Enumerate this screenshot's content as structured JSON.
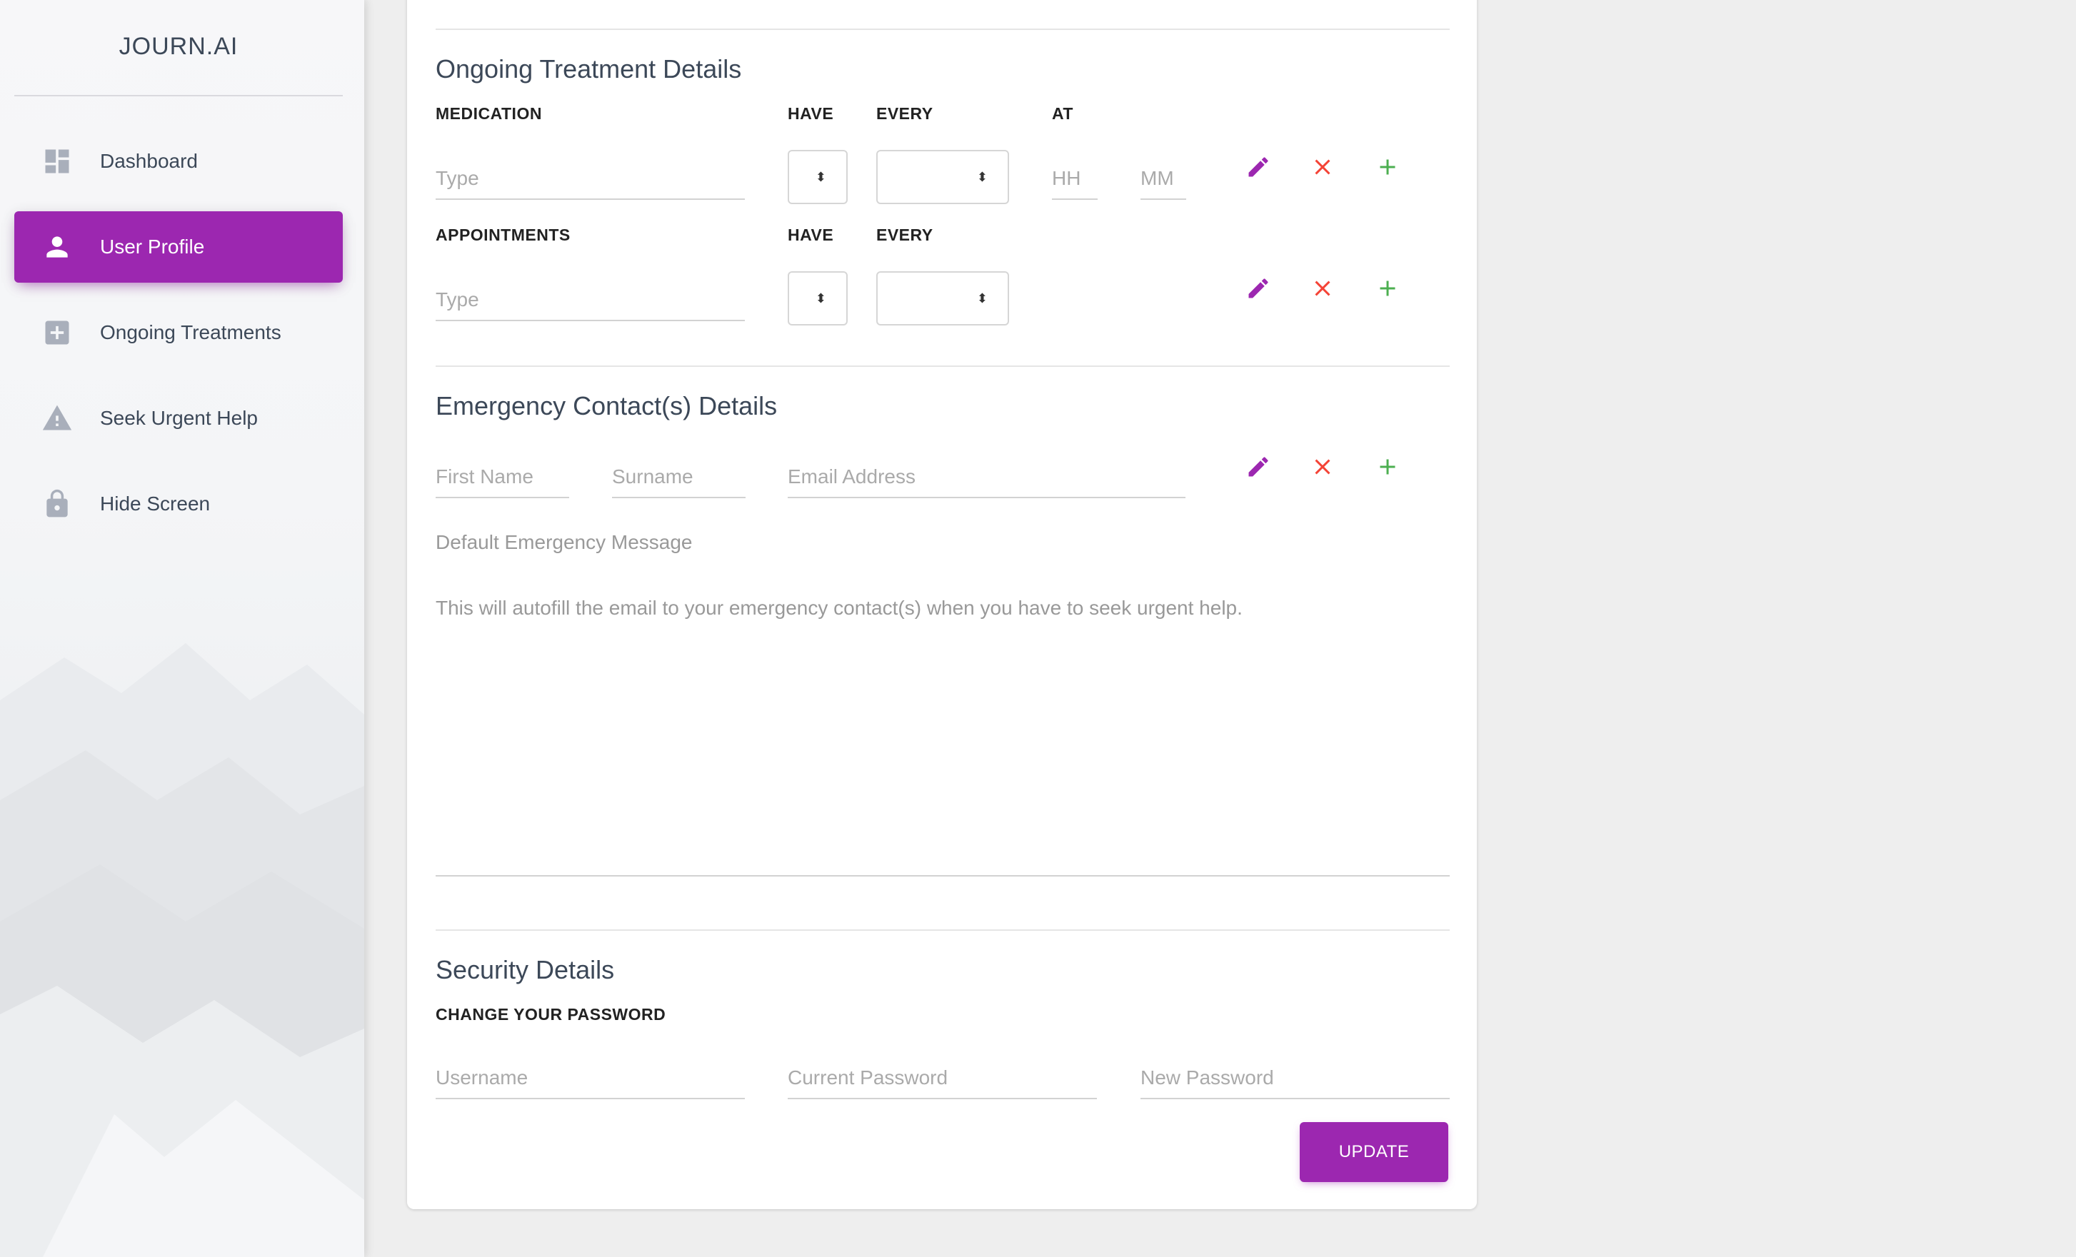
{
  "sidebar": {
    "brand": "JOURN.AI",
    "items": [
      {
        "label": "Dashboard",
        "icon": "dashboard-icon",
        "active": false
      },
      {
        "label": "User Profile",
        "icon": "person-icon",
        "active": true
      },
      {
        "label": "Ongoing Treatments",
        "icon": "medical-plus-icon",
        "active": false
      },
      {
        "label": "Seek Urgent Help",
        "icon": "warning-icon",
        "active": false
      },
      {
        "label": "Hide Screen",
        "icon": "lock-icon",
        "active": false
      }
    ]
  },
  "treatment": {
    "title": "Ongoing Treatment Details",
    "medication": {
      "label": "MEDICATION",
      "have_label": "HAVE",
      "every_label": "EVERY",
      "at_label": "AT",
      "type_placeholder": "Type",
      "hour_placeholder": "HH",
      "minute_placeholder": "MM"
    },
    "appointments": {
      "label": "APPOINTMENTS",
      "have_label": "HAVE",
      "every_label": "EVERY",
      "type_placeholder": "Type"
    }
  },
  "emergency": {
    "title": "Emergency Contact(s) Details",
    "first_name_placeholder": "First Name",
    "surname_placeholder": "Surname",
    "email_placeholder": "Email Address",
    "message_label": "Default Emergency Message",
    "message_placeholder": "This will autofill the email to your emergency contact(s) when you have to seek urgent help."
  },
  "security": {
    "title": "Security Details",
    "subtitle": "CHANGE YOUR PASSWORD",
    "username_placeholder": "Username",
    "current_password_placeholder": "Current Password",
    "new_password_placeholder": "New Password",
    "update_label": "UPDATE"
  },
  "colors": {
    "accent": "#9c27b0",
    "delete": "#f44336",
    "add": "#4caf50",
    "sidebar_icon": "#a9afbb"
  }
}
